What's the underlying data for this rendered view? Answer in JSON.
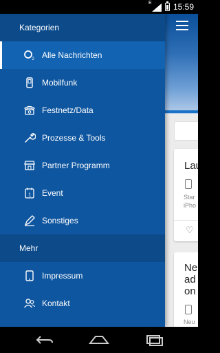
{
  "status_bar": {
    "time": "15:59",
    "network": "E"
  },
  "drawer": {
    "sections": [
      {
        "title": "Kategorien",
        "items": [
          {
            "label": "Alle Nachrichten",
            "icon": "o2-logo-icon",
            "active": true
          },
          {
            "label": "Mobilfunk",
            "icon": "mobile-phone-icon"
          },
          {
            "label": "Festnetz/Data",
            "icon": "landline-phone-icon"
          },
          {
            "label": "Prozesse & Tools",
            "icon": "wrench-icon"
          },
          {
            "label": "Partner Programm",
            "icon": "storefront-icon"
          },
          {
            "label": "Event",
            "icon": "calendar-icon"
          },
          {
            "label": "Sonstiges",
            "icon": "pen-icon"
          }
        ]
      },
      {
        "title": "Mehr",
        "items": [
          {
            "label": "Impressum",
            "icon": "tablet-icon"
          },
          {
            "label": "Kontakt",
            "icon": "contacts-icon"
          }
        ]
      }
    ]
  },
  "background": {
    "cards": [
      {
        "title": "Lau",
        "meta_line1": "Star",
        "meta_line2": "iPho"
      },
      {
        "title_line1": "Ne",
        "title_line2": "ad",
        "title_line3": "on",
        "meta_line1": "Neu"
      }
    ]
  },
  "colors": {
    "drawer_bg": "#0f56a0",
    "section_bg": "#0c4a8a",
    "active_bg": "#1263b2",
    "accent": "#1a73c8"
  }
}
